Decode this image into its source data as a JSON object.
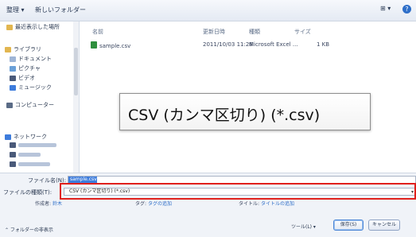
{
  "toolbar": {
    "organize": "整理 ▾",
    "new_folder": "新しいフォルダー",
    "view_icon": "⊞ ▾"
  },
  "nav": {
    "recent": "最近表示した場所",
    "libraries": "ライブラリ",
    "documents": "ドキュメント",
    "pictures": "ピクチャ",
    "videos": "ビデオ",
    "music": "ミュージック",
    "computer": "コンピューター",
    "network": "ネットワーク"
  },
  "files": {
    "columns": [
      "名前",
      "更新日時",
      "種類",
      "サイズ"
    ],
    "rows": [
      {
        "name": "sample.csv",
        "modified": "2011/10/03 11:26",
        "type": "Microsoft Excel ...",
        "size": "1 KB"
      }
    ]
  },
  "zoom_callout": "CSV (カンマ区切り) (*.csv)",
  "save": {
    "filename_label": "ファイル名(N):",
    "filename_value": "sample.csv",
    "filetype_label": "ファイルの種類(T):",
    "filetype_value": "CSV (カンマ区切り) (*.csv)",
    "author_label": "作成者:",
    "author_value": "鈴木",
    "tags_label": "タグ:",
    "tags_value": "タグの追加",
    "title_label": "タイトル:",
    "title_value": "タイトルの追加"
  },
  "footer": {
    "hide_folders": "⌃ フォルダーの非表示",
    "tools": "ツール(L)  ▾",
    "save_button": "保存(S)",
    "cancel_button": "キャンセル"
  },
  "colors": {
    "highlight": "#e0201c",
    "selection": "#3d7cdc"
  }
}
